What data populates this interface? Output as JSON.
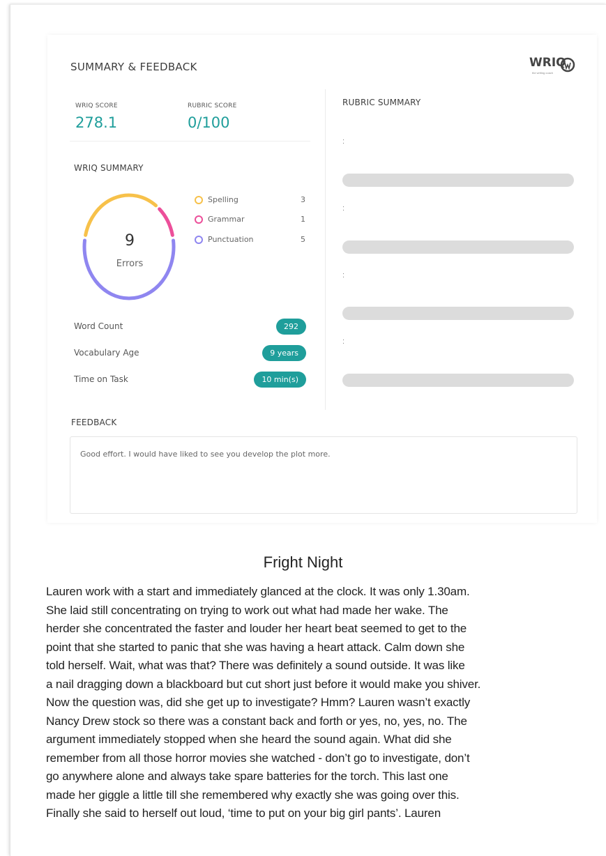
{
  "summary": {
    "title": "SUMMARY & FEEDBACK",
    "logo_text": "WRIQ",
    "logo_tagline": "the writing coach",
    "wriq_score_label": "WRIQ SCORE",
    "wriq_score_value": "278.1",
    "rubric_score_label": "RUBRIC SCORE",
    "rubric_score_value": "0/100"
  },
  "wriq_summary": {
    "heading": "WRIQ SUMMARY",
    "errors_total": "9",
    "errors_label": "Errors",
    "legend": [
      {
        "label": "Spelling",
        "count": "3",
        "color": "#f7c14a"
      },
      {
        "label": "Grammar",
        "count": "1",
        "color": "#ec4f9a"
      },
      {
        "label": "Punctuation",
        "count": "5",
        "color": "#8f86f0"
      }
    ],
    "metrics": [
      {
        "label": "Word Count",
        "value": "292"
      },
      {
        "label": "Vocabulary Age",
        "value": "9 years"
      },
      {
        "label": "Time on Task",
        "value": "10 min(s)"
      }
    ]
  },
  "rubric_summary": {
    "heading": "RUBRIC SUMMARY",
    "items": [
      {
        "label": ":",
        "value": ""
      },
      {
        "label": ":",
        "value": ""
      },
      {
        "label": ":",
        "value": ""
      },
      {
        "label": ":",
        "value": ""
      }
    ]
  },
  "feedback": {
    "heading": "FEEDBACK",
    "text": "Good effort. I would have liked to see you develop the plot more."
  },
  "story": {
    "title": "Fright Night",
    "lines": [
      "Lauren work with a start and immediately glanced at the clock.  It was only 1.30am.",
      "She laid still concentrating on trying to work out what had made her wake.  The",
      "herder she concentrated the faster and louder her heart beat seemed to get to the",
      "point that she started to panic that she was having a heart attack. Calm down she",
      "told herself.  Wait, what was that?  There was definitely a sound outside.  It was like",
      "a nail dragging down a blackboard but cut short just before it would make you shiver.",
      "Now the question was, did she get up to investigate? Hmm? Lauren wasn’t exactly",
      "Nancy Drew stock so there was a constant back and forth or yes, no, yes, no.  The",
      "argument immediately stopped when she heard the sound again.  What did she",
      "remember from all those horror movies she watched - don’t go to investigate, don’t",
      "go anywhere alone and always take spare batteries for the torch.  This last one",
      "made her giggle a little till she remembered why exactly she was going over this.",
      "Finally she said to herself out loud, ‘time to put on your big girl pants’.  Lauren"
    ]
  }
}
